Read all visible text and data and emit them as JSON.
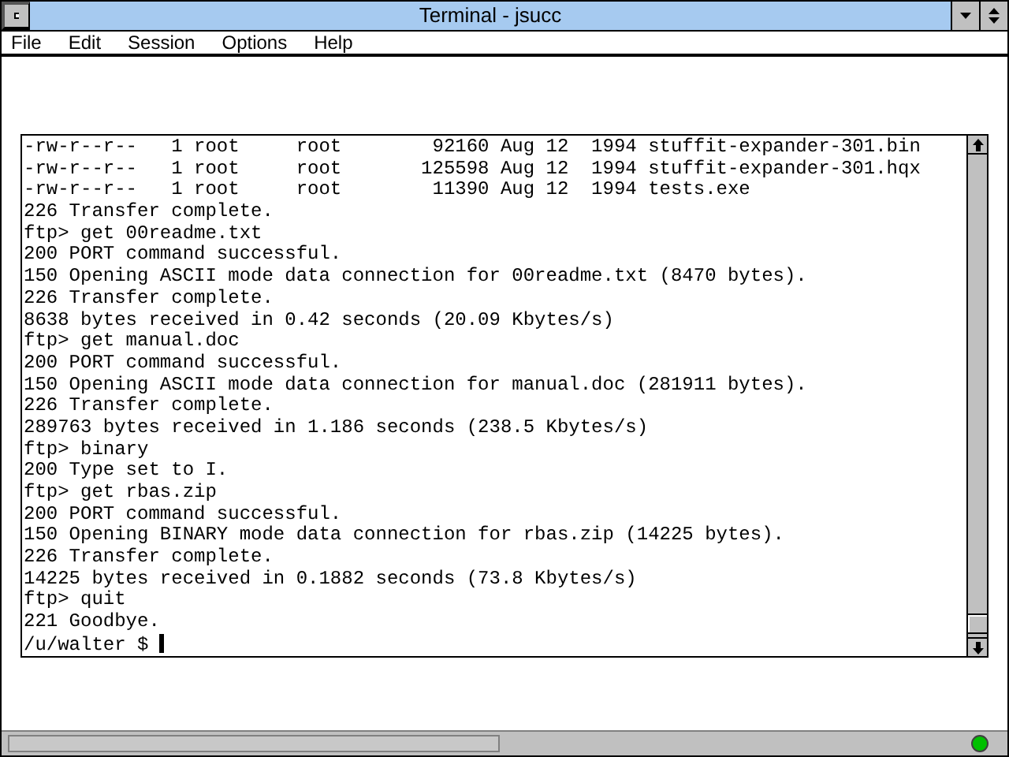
{
  "window": {
    "title": "Terminal - jsucc"
  },
  "menu": [
    "File",
    "Edit",
    "Session",
    "Options",
    "Help"
  ],
  "terminal": {
    "lines": [
      "-rw-r--r--   1 root     root        92160 Aug 12  1994 stuffit-expander-301.bin",
      "-rw-r--r--   1 root     root       125598 Aug 12  1994 stuffit-expander-301.hqx",
      "-rw-r--r--   1 root     root        11390 Aug 12  1994 tests.exe",
      "226 Transfer complete.",
      "ftp> get 00readme.txt",
      "200 PORT command successful.",
      "150 Opening ASCII mode data connection for 00readme.txt (8470 bytes).",
      "226 Transfer complete.",
      "8638 bytes received in 0.42 seconds (20.09 Kbytes/s)",
      "ftp> get manual.doc",
      "200 PORT command successful.",
      "150 Opening ASCII mode data connection for manual.doc (281911 bytes).",
      "226 Transfer complete.",
      "289763 bytes received in 1.186 seconds (238.5 Kbytes/s)",
      "ftp> binary",
      "200 Type set to I.",
      "ftp> get rbas.zip",
      "200 PORT command successful.",
      "150 Opening BINARY mode data connection for rbas.zip (14225 bytes).",
      "226 Transfer complete.",
      "14225 bytes received in 0.1882 seconds (73.8 Kbytes/s)",
      "ftp> quit",
      "221 Goodbye."
    ],
    "prompt": "/u/walter $"
  }
}
